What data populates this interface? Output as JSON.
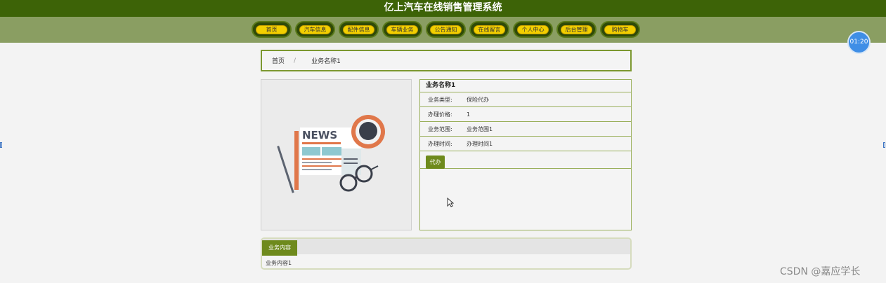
{
  "site": {
    "title": "亿上汽车在线销售管理系统"
  },
  "nav": {
    "items": [
      "首页",
      "汽车信息",
      "配件信息",
      "车辆业务",
      "公告通知",
      "在线留言",
      "个人中心",
      "后台管理",
      "购物车"
    ]
  },
  "timer": {
    "text": "01:20"
  },
  "breadcrumb": {
    "home": "首页",
    "separator": "/",
    "current": "业务名称1"
  },
  "detail": {
    "name": "业务名称1",
    "rows": [
      {
        "label": "业务类型:",
        "value": "保险代办"
      },
      {
        "label": "办理价格:",
        "value": "1"
      },
      {
        "label": "业务范围:",
        "value": "业务范围1"
      },
      {
        "label": "办理时间:",
        "value": "办理时间1"
      }
    ],
    "action_label": "代办"
  },
  "content": {
    "tab_label": "业务内容",
    "text": "业务内容1"
  },
  "image": {
    "headline": "NEWS"
  },
  "watermark": "CSDN @嘉应学长",
  "colors": {
    "header": "#3d6307",
    "nav": "#8a9e62",
    "accent": "#6e8a1c",
    "pill": "#f2cf00"
  }
}
